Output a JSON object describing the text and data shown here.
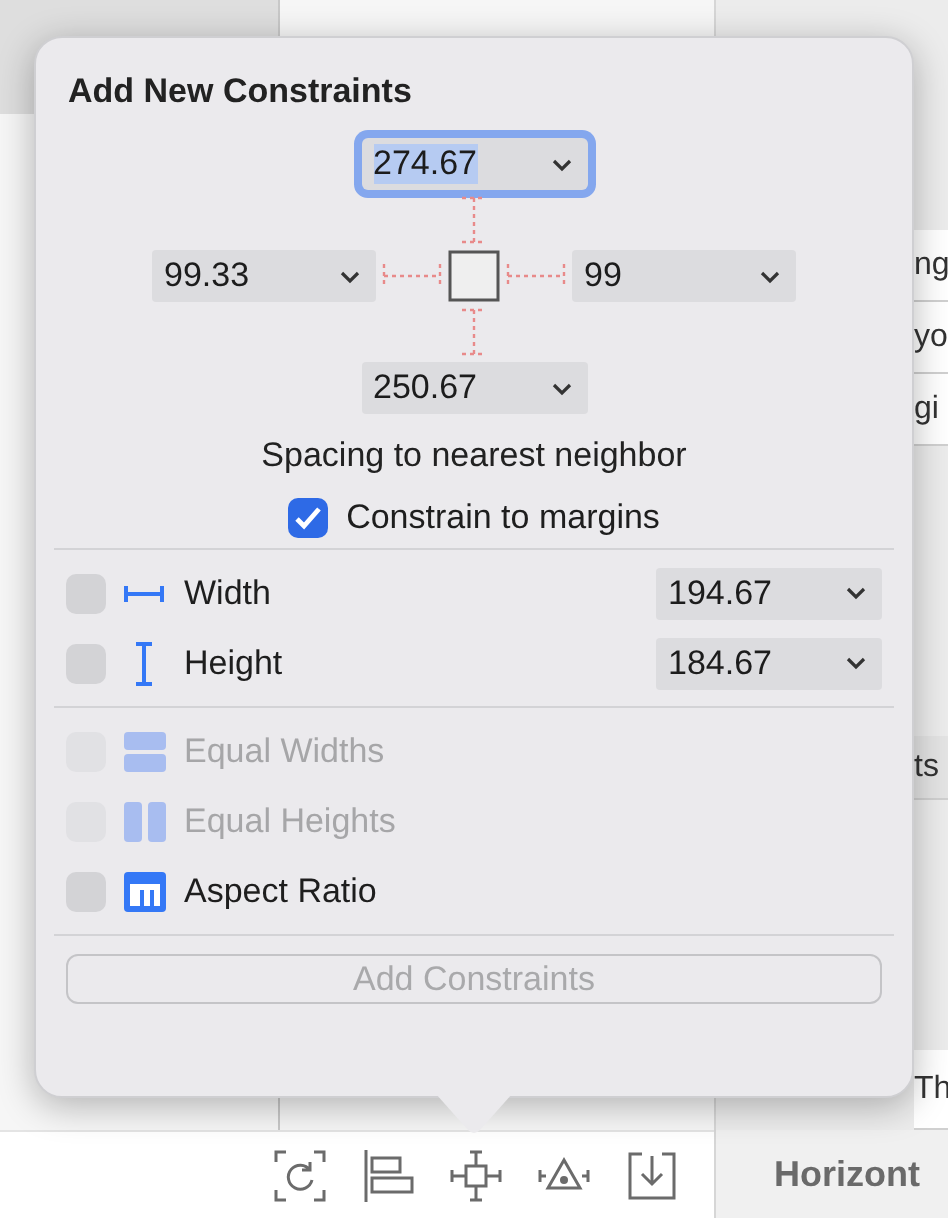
{
  "background": {
    "side_fragments": [
      "ng",
      "yo",
      "gi",
      "ts",
      "Th"
    ],
    "inspector_heading": "Horizont"
  },
  "popover": {
    "title": "Add New Constraints",
    "spacing": {
      "top": {
        "value": "274.67",
        "focused": true
      },
      "left": {
        "value": "99.33",
        "focused": false
      },
      "right": {
        "value": "99",
        "focused": false
      },
      "bottom": {
        "value": "250.67",
        "focused": false
      }
    },
    "spacing_label": "Spacing to nearest neighbor",
    "constrain_to_margins": {
      "label": "Constrain to margins",
      "checked": true
    },
    "size_rows": [
      {
        "kind": "width",
        "label": "Width",
        "checked": false,
        "value": "194.67"
      },
      {
        "kind": "height",
        "label": "Height",
        "checked": false,
        "value": "184.67"
      }
    ],
    "equal_rows": [
      {
        "kind": "equal-widths",
        "label": "Equal Widths",
        "checked": false,
        "disabled": true
      },
      {
        "kind": "equal-heights",
        "label": "Equal Heights",
        "checked": false,
        "disabled": true
      },
      {
        "kind": "aspect-ratio",
        "label": "Aspect Ratio",
        "checked": false,
        "disabled": false
      }
    ],
    "add_button": {
      "label": "Add Constraints",
      "disabled": true
    }
  }
}
